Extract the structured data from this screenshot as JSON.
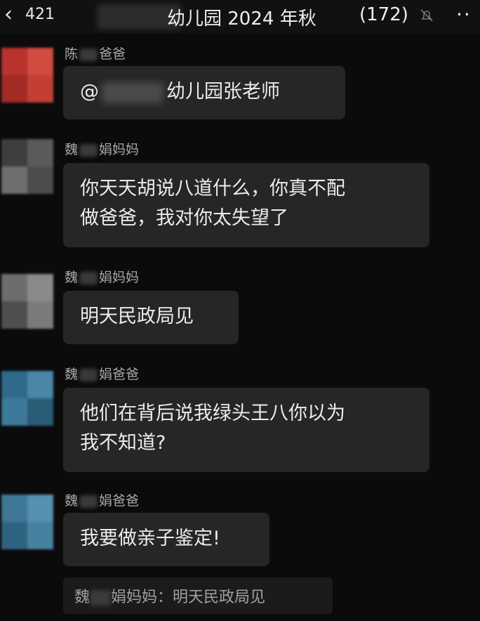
{
  "header": {
    "unread_count": "421",
    "title": "幼儿园 2024 年秋",
    "member_count": "(172)"
  },
  "messages": [
    {
      "sender_first": "陈",
      "sender_last": "爸爸",
      "mention": "@",
      "text": "幼儿园张老师"
    },
    {
      "sender_first": "魏",
      "sender_last": "娟妈妈",
      "text_line1": "你天天胡说八道什么，你真不配",
      "text_line2": "做爸爸，我对你太失望了"
    },
    {
      "sender_first": "魏",
      "sender_last": "娟妈妈",
      "text": "明天民政局见"
    },
    {
      "sender_first": "魏",
      "sender_last": "娟爸爸",
      "text_line1": "他们在背后说我绿头王八你以为",
      "text_line2": "我不知道?"
    },
    {
      "sender_first": "魏",
      "sender_last": "娟爸爸",
      "text": "我要做亲子鉴定!"
    }
  ],
  "quote": {
    "name_first": "魏",
    "name_last": "娟妈妈",
    "text": "：明天民政局见"
  },
  "colors": {
    "background": "#0b0b0b",
    "bubble": "#262626",
    "text": "#ececec",
    "sender": "#a8a8a8"
  },
  "icons": {
    "back": "chevron-left-icon",
    "mute": "bell-muted-icon",
    "more": "more-dots-icon"
  }
}
